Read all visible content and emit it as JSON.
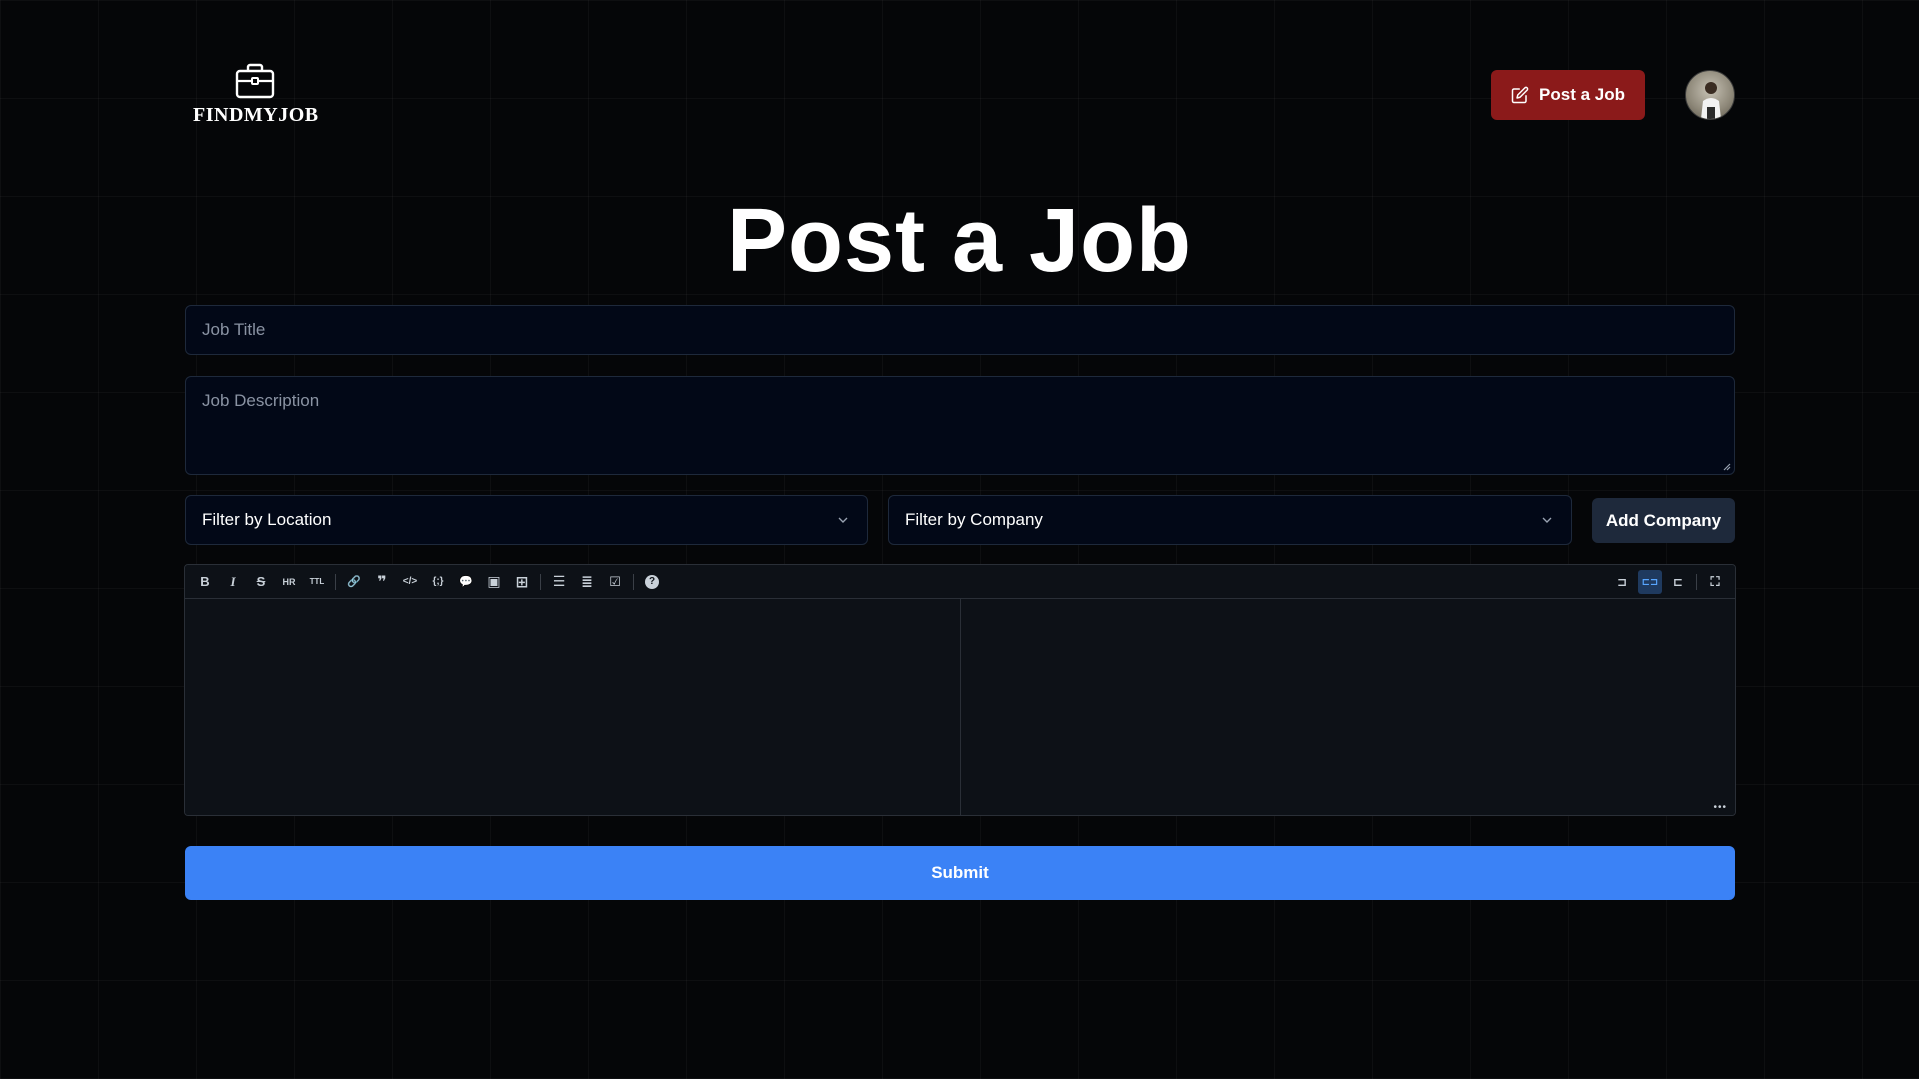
{
  "header": {
    "logo_text": "FINDMYJOB",
    "post_job_label": "Post a Job"
  },
  "main": {
    "title": "Post a Job",
    "job_title_placeholder": "Job Title",
    "job_description_placeholder": "Job Description",
    "location_select": "Filter by Location",
    "company_select": "Filter by Company",
    "add_company_label": "Add Company",
    "submit_label": "Submit"
  },
  "editor": {
    "toolbar_left": [
      {
        "name": "bold-icon",
        "glyph": "B"
      },
      {
        "name": "italic-icon",
        "glyph": "I"
      },
      {
        "name": "strikethrough-icon",
        "glyph": "S"
      },
      {
        "name": "hr-icon",
        "glyph": "HR"
      },
      {
        "name": "title-icon",
        "glyph": "TTL"
      },
      {
        "name": "link-icon",
        "glyph": "🔗"
      },
      {
        "name": "quote-icon",
        "glyph": "❞"
      },
      {
        "name": "code-icon",
        "glyph": "</>"
      },
      {
        "name": "code-block-icon",
        "glyph": "{;}"
      },
      {
        "name": "comment-icon",
        "glyph": "💬"
      },
      {
        "name": "image-icon",
        "glyph": "▣"
      },
      {
        "name": "table-icon",
        "glyph": "⊞"
      },
      {
        "name": "unordered-list-icon",
        "glyph": "☰"
      },
      {
        "name": "ordered-list-icon",
        "glyph": "≣"
      },
      {
        "name": "checked-list-icon",
        "glyph": "☑"
      },
      {
        "name": "help-icon",
        "glyph": "?"
      }
    ],
    "toolbar_right": [
      {
        "name": "edit-mode-icon",
        "glyph": "⊐",
        "active": false
      },
      {
        "name": "live-mode-icon",
        "glyph": "⊏⊐",
        "active": true
      },
      {
        "name": "preview-mode-icon",
        "glyph": "⊏",
        "active": false
      },
      {
        "name": "fullscreen-icon",
        "glyph": "⛶",
        "active": false
      }
    ]
  },
  "colors": {
    "post_button": "#8b1a1a",
    "submit_button": "#3b82f6",
    "add_company_button": "#1e293b"
  }
}
